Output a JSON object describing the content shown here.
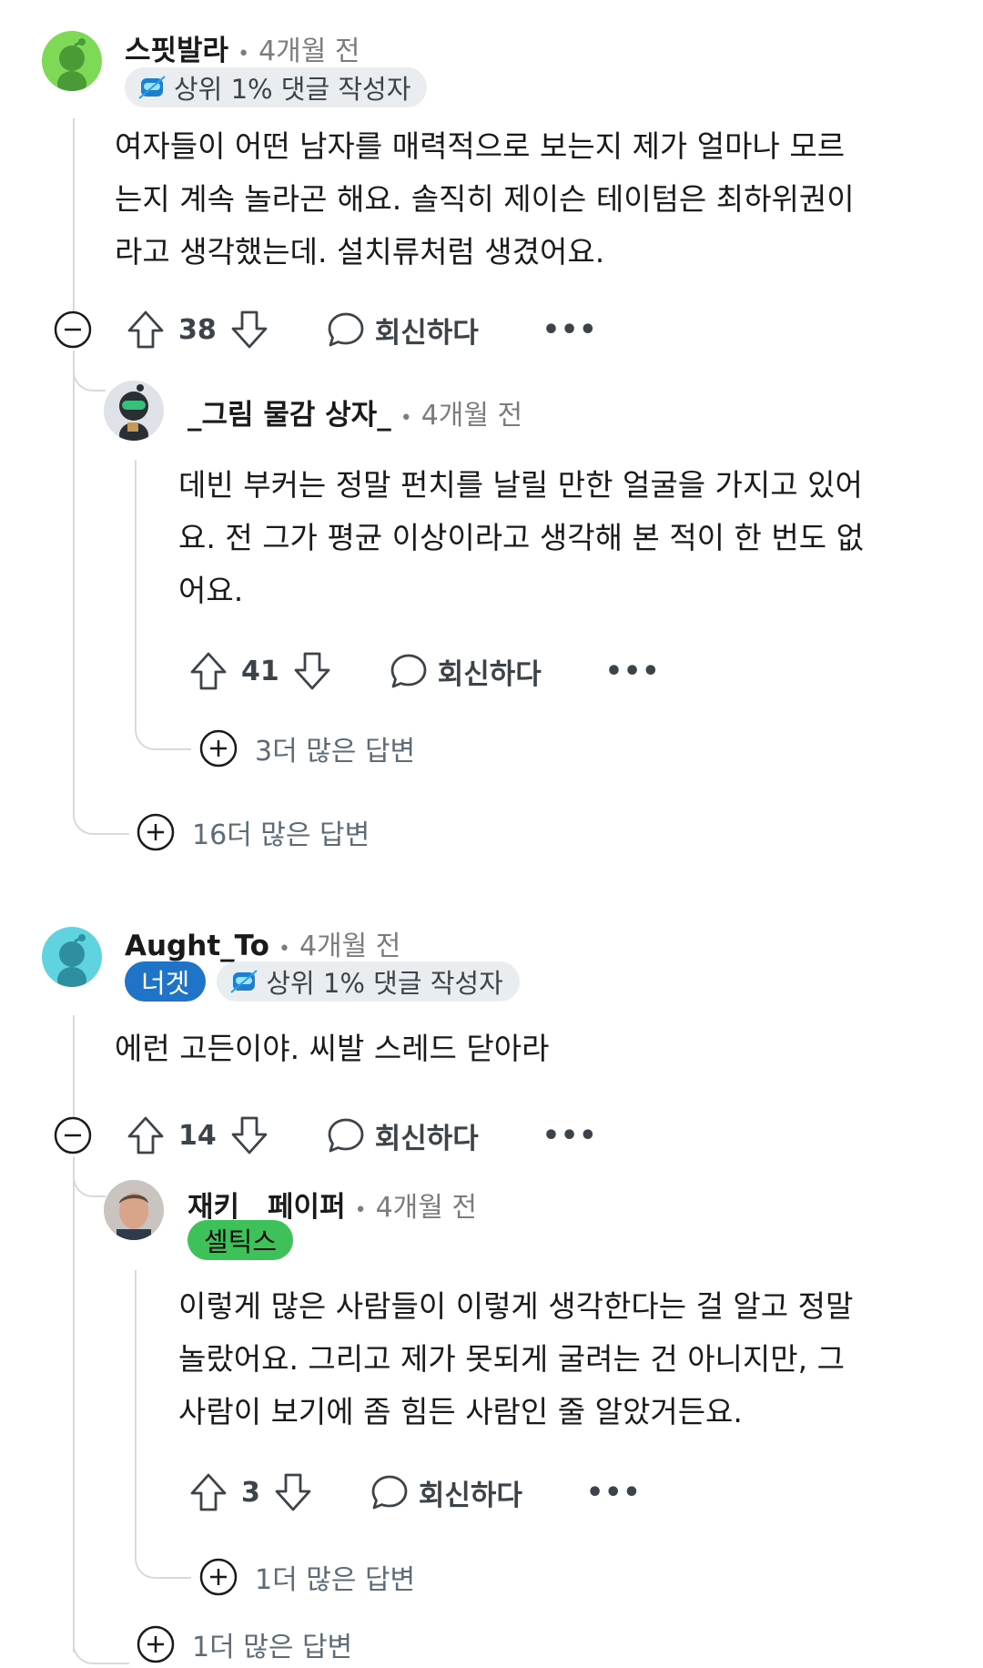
{
  "comments": [
    {
      "username": "스핏발라",
      "time": "4개월 전",
      "badge": "상위 1% 댓글 작성자",
      "body": [
        "여자들이 어떤 남자를 매력적으로 보는지 제가 얼마나 모르",
        "는지 계속 놀라곤 해요. 솔직히 제이슨 테이텀은 최하위권이",
        "라고 생각했는데. 설치류처럼 생겼어요."
      ],
      "votes": "38",
      "reply_label": "회신하다",
      "reply": {
        "username": "_그림 물감 상자_",
        "time": "4개월 전",
        "body": [
          "데빈 부커는 정말 펀치를 날릴 만한 얼굴을 가지고 있어",
          "요. 전 그가 평균 이상이라고 생각해 본 적이 한 번도 없",
          "어요."
        ],
        "votes": "41",
        "reply_label": "회신하다",
        "more_replies": "3더 많은 답변"
      },
      "more_replies": "16더 많은 답변"
    },
    {
      "username": "Aught_To",
      "time": "4개월 전",
      "flair": "너겟",
      "badge": "상위 1% 댓글 작성자",
      "body": [
        "에런 고든이야. 씨발 스레드 닫아라"
      ],
      "votes": "14",
      "reply_label": "회신하다",
      "reply": {
        "username": "재키__페이퍼",
        "time": "4개월 전",
        "flair": "셀틱스",
        "body": [
          "이렇게 많은 사람들이 이렇게 생각한다는 걸 알고 정말",
          "놀랐어요. 그리고 제가 못되게 굴려는 건 아니지만, 그",
          "사람이 보기에 좀 힘든 사람인 줄 알았거든요."
        ],
        "votes": "3",
        "reply_label": "회신하다",
        "more_replies": "1더 많은 답변"
      },
      "more_replies": "1더 많은 답변"
    }
  ],
  "colors": {
    "flair_blue": "#1f74c8",
    "flair_green": "#3fc15a",
    "avatar_green": "#7ed957",
    "avatar_teal": "#5fd3e0"
  }
}
